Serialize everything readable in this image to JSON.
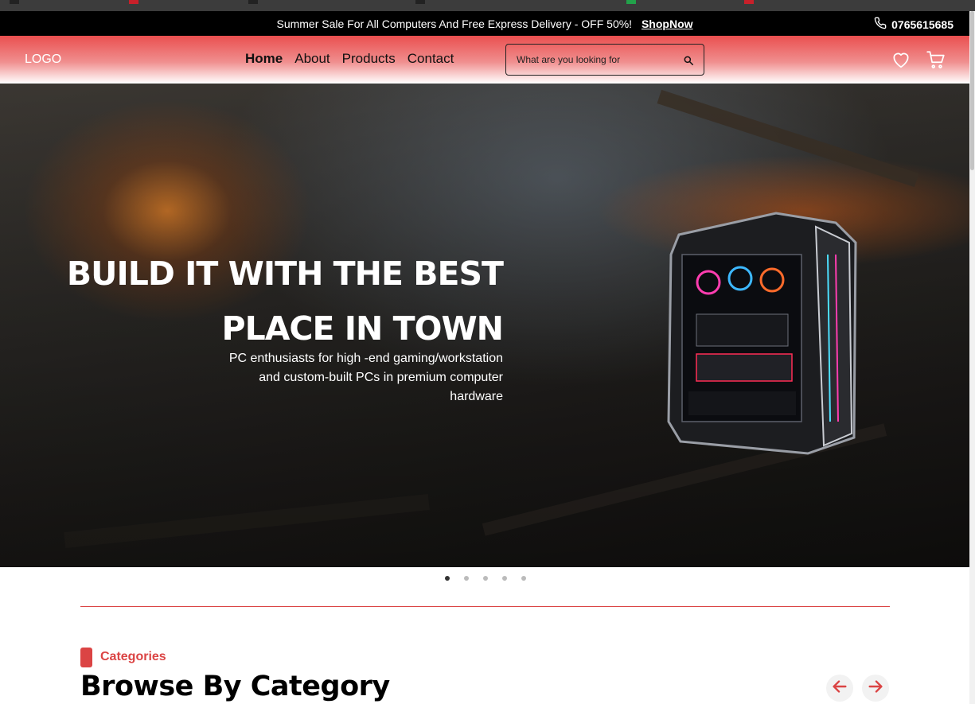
{
  "topbar": {
    "promo_text": "Summer Sale For All Computers And Free Express Delivery - OFF 50%!",
    "promo_link": "ShopNow",
    "phone": "0765615685"
  },
  "navbar": {
    "logo": "LOGO",
    "menu": [
      {
        "label": "Home",
        "active": true
      },
      {
        "label": "About",
        "active": false
      },
      {
        "label": "Products",
        "active": false
      },
      {
        "label": "Contact",
        "active": false
      }
    ],
    "search": {
      "placeholder": "What are you looking for",
      "value": ""
    },
    "icons": [
      "heart-icon",
      "cart-icon"
    ]
  },
  "hero": {
    "title_line1": "BUILD IT WITH THE BEST",
    "title_line2": "PLACE IN TOWN",
    "subtitle_line1": "PC enthusiasts for high -end gaming/workstation",
    "subtitle_line2": "and custom-built PCs in premium computer",
    "subtitle_line3": "hardware",
    "slide_count": 5,
    "active_slide": 1
  },
  "categories": {
    "label": "Categories",
    "heading": "Browse By Category",
    "prev_icon": "arrow-left-icon",
    "next_icon": "arrow-right-icon"
  },
  "colors": {
    "accent": "#db4444",
    "topbar_bg": "#000000"
  }
}
